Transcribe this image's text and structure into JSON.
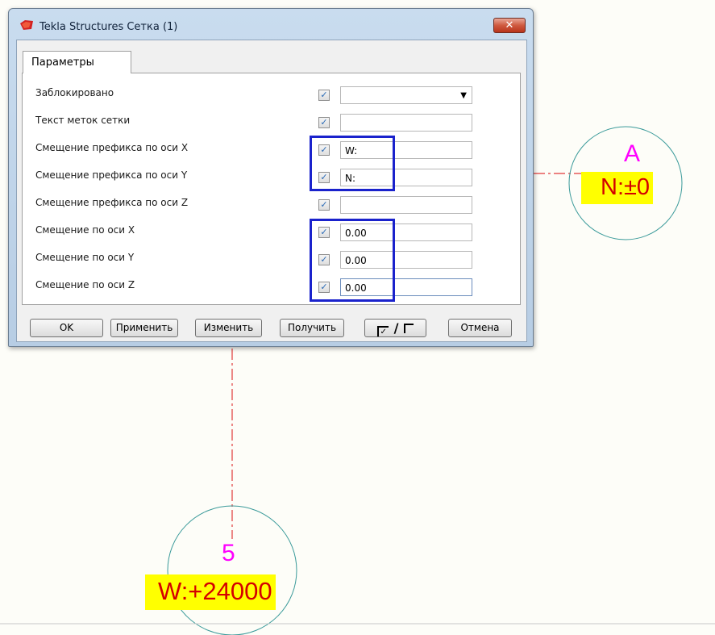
{
  "window": {
    "title": "Tekla Structures  Сетка (1)",
    "close_label": "✕"
  },
  "tabs": [
    {
      "label": "Параметры",
      "selected": true
    }
  ],
  "rows": [
    {
      "label": "Заблокировано",
      "checked": true,
      "value": "",
      "has_dropdown": true
    },
    {
      "label": "Текст меток сетки",
      "checked": true,
      "value": ""
    },
    {
      "label": "Смещение префикса по оси X",
      "checked": true,
      "value": "W:"
    },
    {
      "label": "Смещение префикса по оси Y",
      "checked": true,
      "value": "N:"
    },
    {
      "label": "Смещение префикса по оси Z",
      "checked": true,
      "value": ""
    },
    {
      "label": "Смещение по оси X",
      "checked": true,
      "value": "0.00"
    },
    {
      "label": "Смещение по оси Y",
      "checked": true,
      "value": "0.00"
    },
    {
      "label": "Смещение по оси Z",
      "checked": true,
      "value": "0.00"
    }
  ],
  "buttons": {
    "ok": "OK",
    "apply": "Применить",
    "modify": "Изменить",
    "get": "Получить",
    "toggle_on": "✓",
    "toggle_sep": "/",
    "cancel": "Отмена"
  },
  "grid_labels": {
    "a_label": "A",
    "a_value": "N:±0",
    "five_label": "5",
    "five_value": "W:+24000"
  },
  "colors": {
    "highlight_box": "#1a22cc",
    "axis_line": "#e23a3a",
    "bubble": "#3a9a9a",
    "label_text": "#ff00ff",
    "value_text": "#d40000",
    "value_background": "#ffff00"
  }
}
